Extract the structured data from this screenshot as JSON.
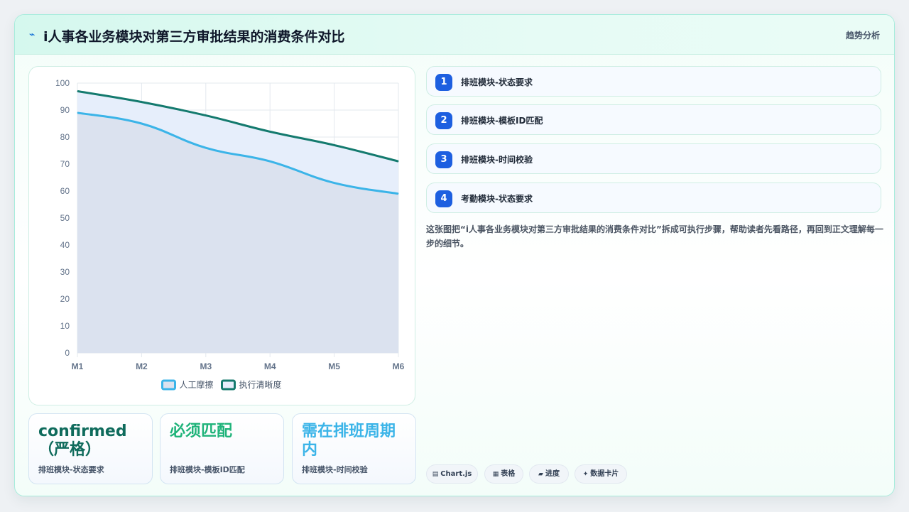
{
  "header": {
    "icon": "bolt-icon",
    "title": "i人事各业务模块对第三方审批结果的消费条件对比",
    "trend_label": "趋势分析"
  },
  "chart_data": {
    "type": "area",
    "x": [
      "M1",
      "M2",
      "M3",
      "M4",
      "M5",
      "M6"
    ],
    "ylim": [
      0,
      100
    ],
    "yticks": [
      0,
      10,
      20,
      30,
      40,
      50,
      60,
      70,
      80,
      90,
      100
    ],
    "grid": true,
    "legend_position": "bottom",
    "series": [
      {
        "name": "人工摩擦",
        "values": [
          89,
          85,
          76,
          71,
          63,
          59
        ],
        "color": "#3bb4e8",
        "fill": "#dbe2ef"
      },
      {
        "name": "执行清晰度",
        "values": [
          97,
          93,
          88,
          82,
          77,
          71
        ],
        "color": "#147a6e",
        "fill": "#e6eefb"
      }
    ]
  },
  "stats": [
    {
      "value": "confirmed（严格）",
      "label": "排班模块-状态要求",
      "color": "#0f6b5c"
    },
    {
      "value": "必须匹配",
      "label": "排班模块-模板ID匹配",
      "color": "#1fb37a"
    },
    {
      "value": "需在排班周期内",
      "label": "排班模块-时间校验",
      "color": "#3bb4e8"
    }
  ],
  "steps": [
    {
      "num": "1",
      "label": "排班模块-状态要求"
    },
    {
      "num": "2",
      "label": "排班模块-模板ID匹配"
    },
    {
      "num": "3",
      "label": "排班模块-时间校验"
    },
    {
      "num": "4",
      "label": "考勤模块-状态要求"
    }
  ],
  "description": "这张图把“i人事各业务模块对第三方审批结果的消费条件对比”拆成可执行步骤，帮助读者先看路径，再回到正文理解每一步的细节。",
  "tags": [
    {
      "icon": "chart-icon",
      "label": "Chart.js"
    },
    {
      "icon": "table-icon",
      "label": "表格"
    },
    {
      "icon": "progress-icon",
      "label": "进度"
    },
    {
      "icon": "card-icon",
      "label": "数据卡片"
    }
  ]
}
